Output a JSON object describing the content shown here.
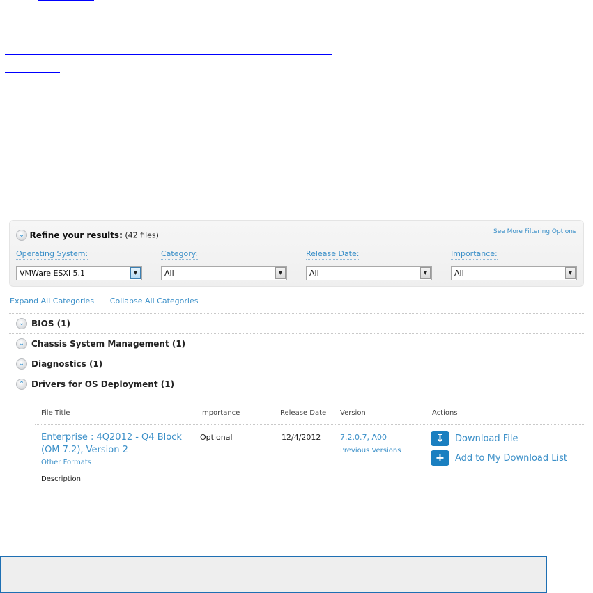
{
  "filters": {
    "title": "Refine your results:",
    "count": "(42 files)",
    "more_link": "See More Filtering Options",
    "fields": [
      {
        "label": "Operating System:",
        "value": "VMWare ESXi 5.1"
      },
      {
        "label": "Category:",
        "value": "All"
      },
      {
        "label": "Release Date:",
        "value": "All"
      },
      {
        "label": "Importance:",
        "value": "All"
      }
    ]
  },
  "expand_all": "Expand All Categories",
  "separator": "|",
  "collapse_all": "Collapse All Categories",
  "categories": [
    {
      "label": "BIOS (1)"
    },
    {
      "label": "Chassis System Management (1)"
    },
    {
      "label": "Diagnostics (1)"
    },
    {
      "label": "Drivers for OS Deployment (1)"
    }
  ],
  "table": {
    "headers": [
      "File Title",
      "Importance",
      "Release Date",
      "Version",
      "Actions"
    ],
    "row": {
      "title_line1": "Enterprise : 4Q2012 - Q4 Block",
      "title_line2": "(OM 7.2), Version 2",
      "other_formats": "Other Formats",
      "importance": "Optional",
      "release_date": "12/4/2012",
      "version": "7.2.0.7, A00",
      "previous_versions": "Previous Versions",
      "download": "Download File",
      "add_list": "Add to My Download List",
      "description": "Description"
    }
  }
}
